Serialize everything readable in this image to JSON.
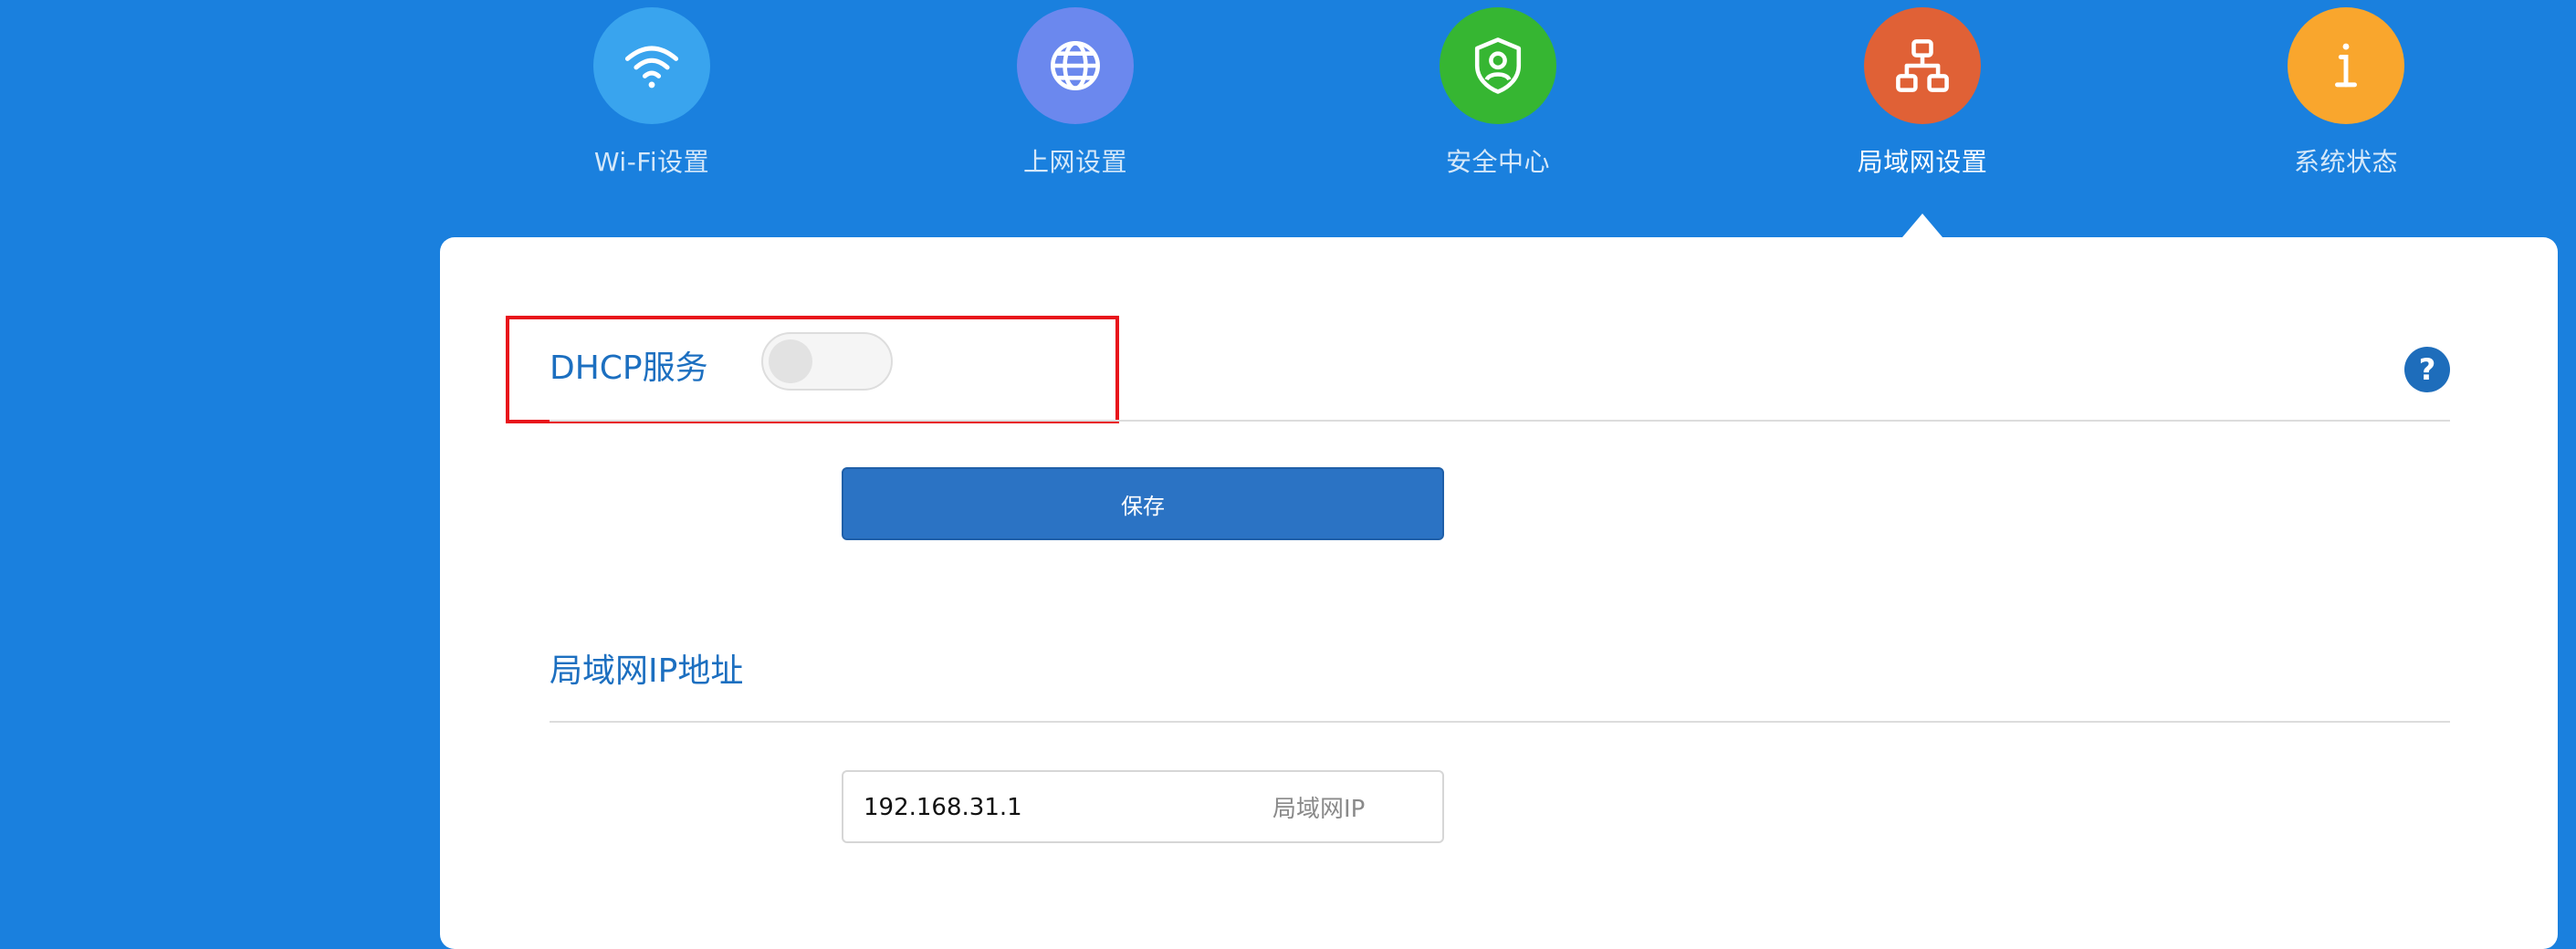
{
  "nav": {
    "items": [
      {
        "label": "Wi-Fi设置",
        "icon": "wifi-icon",
        "color": "#39a4ee"
      },
      {
        "label": "上网设置",
        "icon": "globe-icon",
        "color": "#6b88ee"
      },
      {
        "label": "安全中心",
        "icon": "shield-user-icon",
        "color": "#36b632"
      },
      {
        "label": "局域网设置",
        "icon": "network-icon",
        "color": "#e06136",
        "active": true
      },
      {
        "label": "系统状态",
        "icon": "info-icon",
        "color": "#f9a62d"
      }
    ]
  },
  "dhcp": {
    "label": "DHCP服务",
    "enabled": false,
    "help": "?",
    "highlight_color": "#e8141b"
  },
  "save_button": {
    "label": "保存"
  },
  "lan_ip": {
    "title": "局域网IP地址",
    "value": "192.168.31.1",
    "suffix": "局域网IP"
  },
  "colors": {
    "background": "#1a80de",
    "panel": "#ffffff",
    "title_text": "#1c6fc0",
    "button": "#2b73c4"
  }
}
